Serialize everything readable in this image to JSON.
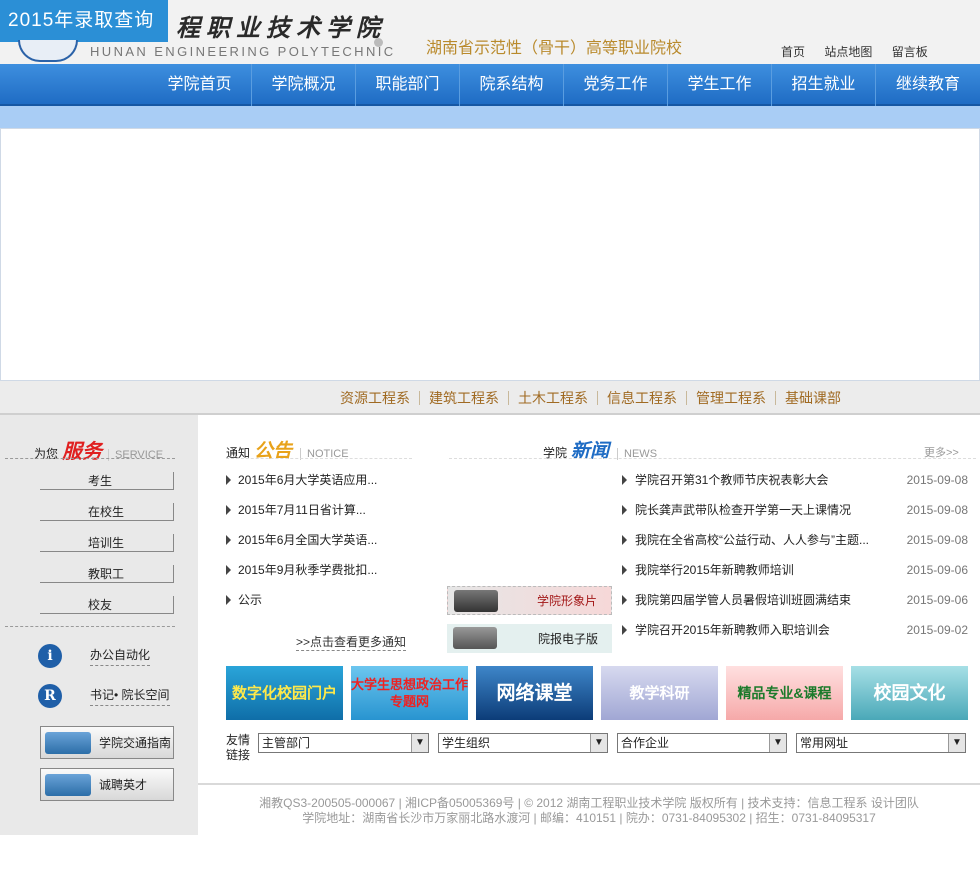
{
  "header": {
    "badge": "2015年录取查询",
    "school_name_cn": "程职业技术学院",
    "school_name_en": "HUNAN ENGINEERING POLYTECHNIC",
    "slogan": "湖南省示范性（骨干）高等职业院校",
    "toplinks": [
      "首页",
      "站点地图",
      "留言板"
    ]
  },
  "nav": [
    "学院首页",
    "学院概况",
    "职能部门",
    "院系结构",
    "党务工作",
    "学生工作",
    "招生就业",
    "继续教育"
  ],
  "departments": [
    "资源工程系",
    "建筑工程系",
    "土木工程系",
    "信息工程系",
    "管理工程系",
    "基础课部"
  ],
  "service": {
    "prefix": "为您",
    "big": "服务",
    "en": "SERVICE",
    "items": [
      "考生",
      "在校生",
      "培训生",
      "教职工",
      "校友"
    ],
    "links": [
      {
        "icon": "i",
        "label": "办公自动化"
      },
      {
        "icon": "R",
        "label": "书记• 院长空间"
      }
    ],
    "image_buttons": [
      "学院交通指南",
      "诚聘英才"
    ]
  },
  "notice": {
    "prefix": "通知",
    "big": "公告",
    "en": "NOTICE",
    "items": [
      "2015年6月大学英语应用...",
      "2015年7月11日省计算...",
      "2015年6月全国大学英语...",
      "2015年9月秋季学费批扣...",
      "公示"
    ],
    "more": ">>点击查看更多通知"
  },
  "promos": [
    "学院形象片",
    "院报电子版"
  ],
  "news": {
    "prefix": "学院",
    "big": "新闻",
    "en": "NEWS",
    "more": "更多>>",
    "items": [
      {
        "title": "学院召开第31个教师节庆祝表彰大会",
        "date": "2015-09-08"
      },
      {
        "title": "院长龚声武带队检查开学第一天上课情况",
        "date": "2015-09-08"
      },
      {
        "title": "我院在全省高校“公益行动、人人参与”主题...",
        "date": "2015-09-08"
      },
      {
        "title": "我院举行2015年新聘教师培训",
        "date": "2015-09-06"
      },
      {
        "title": "我院第四届学管人员暑假培训班圆满结束",
        "date": "2015-09-06"
      },
      {
        "title": "学院召开2015年新聘教师入职培训会",
        "date": "2015-09-02"
      }
    ]
  },
  "tiles": [
    "数字化校园门户",
    "大学生思想政治工作专题网",
    "网络课堂",
    "教学科研",
    "精品专业&课程",
    "校园文化"
  ],
  "friend_links": {
    "label": "友情链接",
    "selects": [
      "主管部门",
      "学生组织",
      "合作企业",
      "常用网址"
    ]
  },
  "footer": {
    "line1": "湘教QS3-200505-000067 | 湘ICP备05005369号 | © 2012 湖南工程职业技术学院 版权所有 | 技术支持：信息工程系 设计团队",
    "line2": "学院地址：湖南省长沙市万家丽北路水渡河 | 邮编：410151 | 院办：0731-84095302 | 招生：0731-84095317"
  },
  "colors": {
    "nav": "#1f6cc4",
    "badge": "#2b8fd6",
    "accent_red": "#e02020",
    "dept_text": "#a06a22"
  }
}
